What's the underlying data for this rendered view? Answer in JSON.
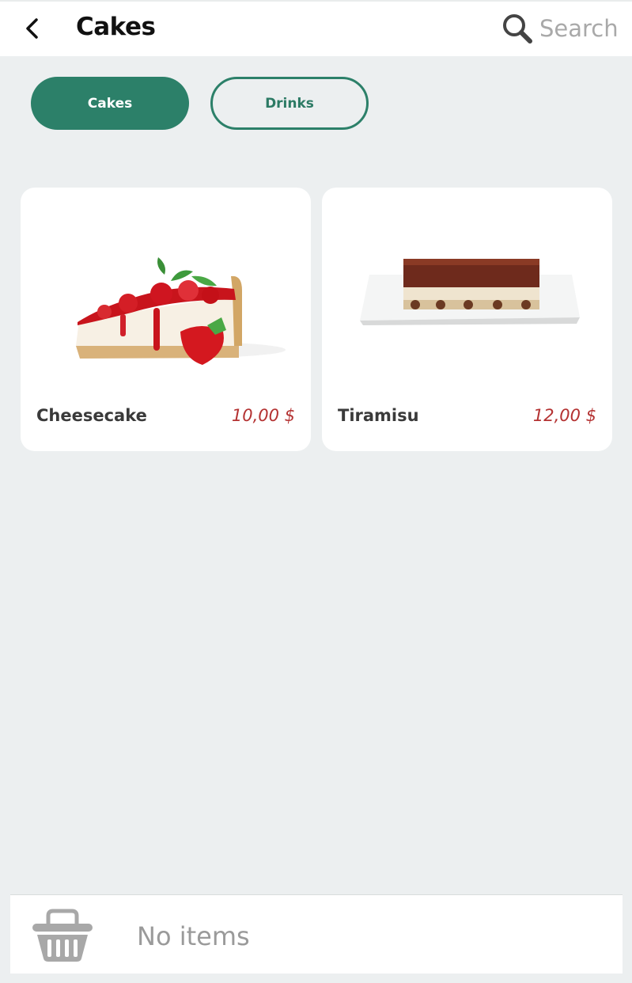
{
  "header": {
    "title": "Cakes",
    "search_placeholder": "Search"
  },
  "tabs": [
    {
      "label": "Cakes",
      "active": true
    },
    {
      "label": "Drinks",
      "active": false
    }
  ],
  "products": [
    {
      "name": "Cheesecake",
      "price": "10,00 $",
      "image": "cheesecake-slice-image"
    },
    {
      "name": "Tiramisu",
      "price": "12,00 $",
      "image": "tiramisu-plate-image"
    }
  ],
  "cart": {
    "status": "No items",
    "icon": "basket-icon"
  },
  "colors": {
    "accent": "#2c8069",
    "price": "#b43232",
    "background": "#eceff0"
  }
}
